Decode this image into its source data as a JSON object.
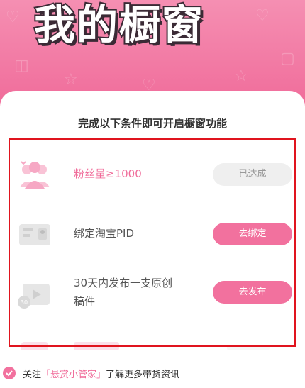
{
  "banner": {
    "title": "我的橱窗"
  },
  "card": {
    "title": "完成以下条件即可开启橱窗功能"
  },
  "conditions": [
    {
      "label": "粉丝量≥1000",
      "action": "已达成",
      "icon": "fans-icon"
    },
    {
      "label": "绑定淘宝PID",
      "action": "去绑定",
      "icon": "taobao-card-icon"
    },
    {
      "label_line1": "30天内发布一支原创",
      "label_line2": "稿件",
      "action": "去发布",
      "icon": "video-post-icon"
    }
  ],
  "footer": {
    "prefix": "关注",
    "link": "「悬赏小管家」",
    "suffix": "了解更多带货资讯"
  },
  "colors": {
    "accent": "#f2719e",
    "highlight_border": "#e0141e"
  }
}
